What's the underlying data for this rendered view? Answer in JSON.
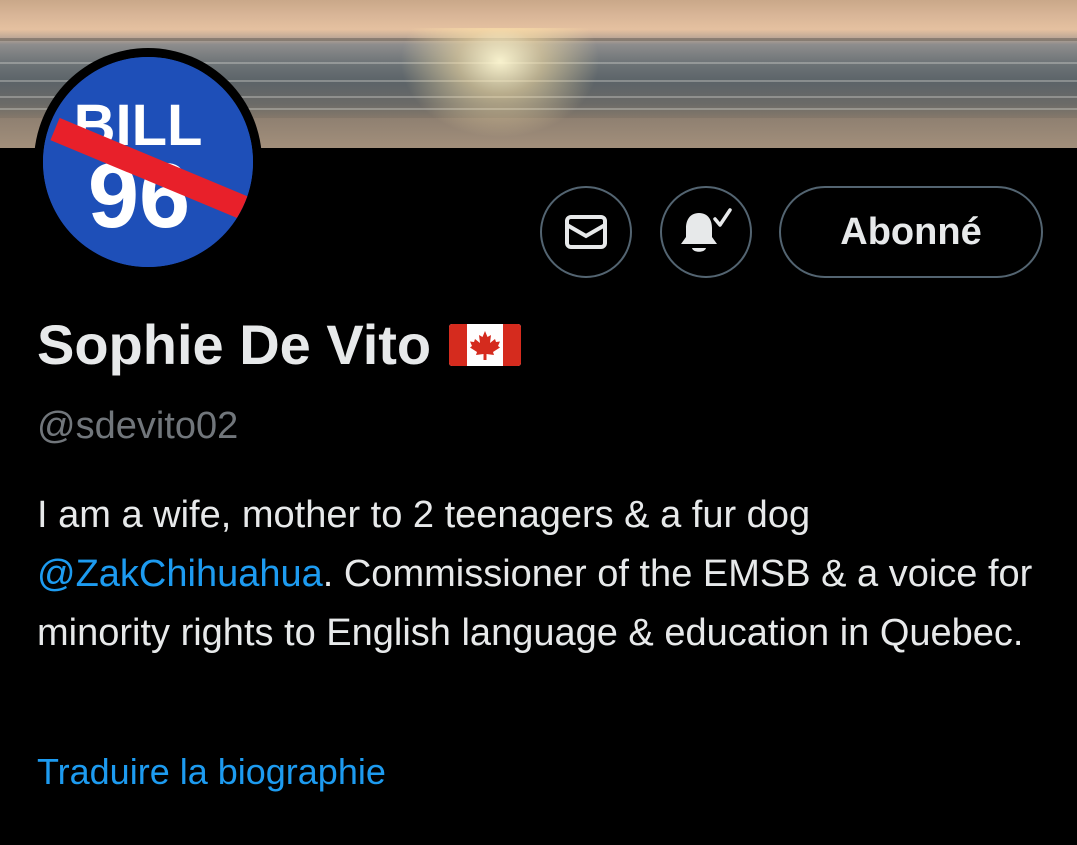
{
  "header": {
    "banner_image": "sunset-beach-photo",
    "avatar_logo_lines": [
      "BILL",
      "96"
    ]
  },
  "actions": {
    "message_icon": "envelope-icon",
    "notification_icon": "bell-check-icon",
    "follow_label": "Abonné"
  },
  "profile": {
    "display_name": "Sophie De Vito",
    "flag_emoji": "🇨🇦",
    "handle": "@sdevito02"
  },
  "bio": {
    "part1": "I am a wife, mother to 2 teenagers & a fur dog ",
    "mention": "@ZakChihuahua",
    "part2": ". Commissioner of the EMSB & a voice for minority rights to English language & education in Quebec."
  },
  "links": {
    "translate_bio": "Traduire la biographie"
  },
  "colors": {
    "background": "#000000",
    "text": "#e7e9ea",
    "muted": "#71767b",
    "link": "#1d9bf0",
    "border": "#536471"
  }
}
